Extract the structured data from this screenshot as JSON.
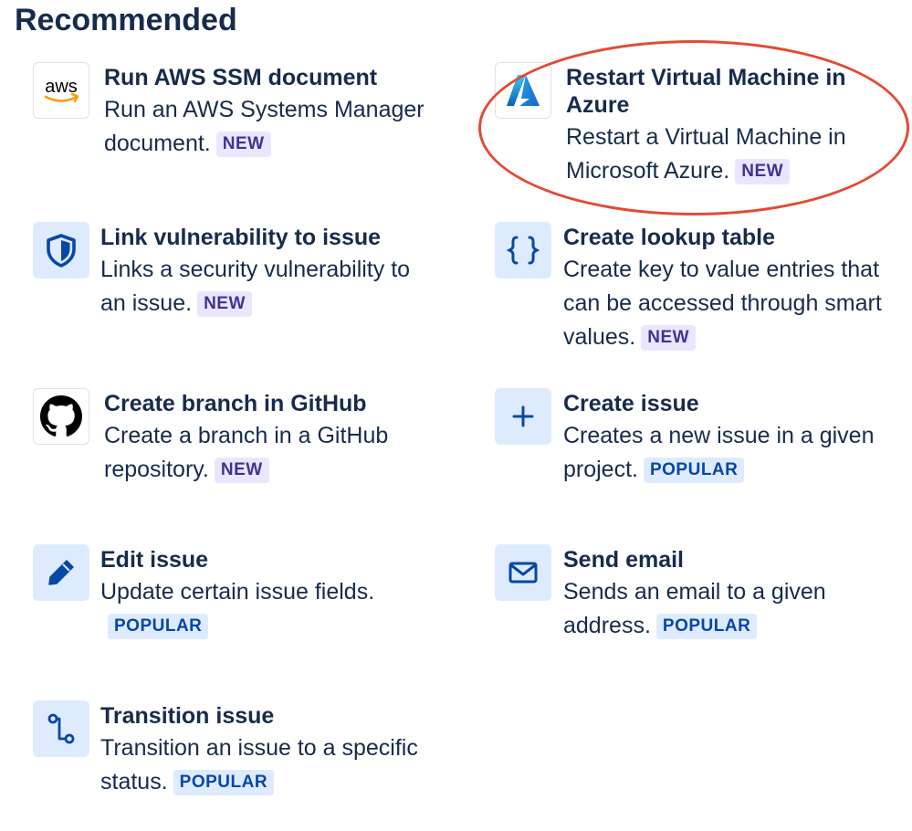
{
  "heading": "Recommended",
  "cards": [
    {
      "title": "Run AWS SSM document",
      "desc": "Run an AWS Systems Manager document.",
      "badge": "NEW",
      "icon": "aws-logo-icon"
    },
    {
      "title": "Restart Virtual Machine in Azure",
      "desc": "Restart a Virtual Machine in Microsoft Azure.",
      "badge": "NEW",
      "icon": "azure-logo-icon"
    },
    {
      "title": "Link vulnerability to issue",
      "desc": "Links a security vulnerability to an issue.",
      "badge": "NEW",
      "icon": "shield-icon"
    },
    {
      "title": "Create lookup table",
      "desc": "Create key to value entries that can be accessed through smart values.",
      "badge": "NEW",
      "icon": "curly-braces-icon"
    },
    {
      "title": "Create branch in GitHub",
      "desc": "Create a branch in a GitHub repository.",
      "badge": "NEW",
      "icon": "github-logo-icon"
    },
    {
      "title": "Create issue",
      "desc": "Creates a new issue in a given project.",
      "badge": "POPULAR",
      "icon": "plus-icon"
    },
    {
      "title": "Edit issue",
      "desc": "Update certain issue fields.",
      "badge": "POPULAR",
      "icon": "pencil-icon"
    },
    {
      "title": "Send email",
      "desc": "Sends an email to a given address.",
      "badge": "POPULAR",
      "icon": "envelope-icon"
    },
    {
      "title": "Transition issue",
      "desc": "Transition an issue to a specific status.",
      "badge": "POPULAR",
      "icon": "transition-icon"
    }
  ],
  "aws_logo_text": "aws",
  "colors": {
    "text": "#172b4d",
    "new_badge_bg": "#eae6ff",
    "new_badge_text": "#403294",
    "popular_badge_bg": "#deebff",
    "popular_badge_text": "#0747a6",
    "icon_tint": "#deebff",
    "icon_color": "#0052cc",
    "highlight": "#e34a33"
  }
}
